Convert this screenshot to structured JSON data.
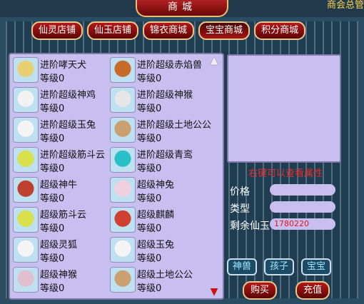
{
  "window": {
    "title": "商城",
    "corner_note": "商会总管"
  },
  "tabs": [
    {
      "label": "仙灵店铺"
    },
    {
      "label": "仙玉店铺"
    },
    {
      "label": "锦衣商城"
    },
    {
      "label": "宝宝商城",
      "active": true
    },
    {
      "label": "积分商城"
    }
  ],
  "items": [
    {
      "name": "进阶哮天犬",
      "level": "等级0",
      "icon": "hound-icon",
      "color": "#e8d070"
    },
    {
      "name": "进阶超级赤焰兽",
      "level": "等级0",
      "icon": "fire-beast-icon",
      "color": "#c86a2a"
    },
    {
      "name": "进阶超级神鸡",
      "level": "等级0",
      "icon": "rooster-icon",
      "color": "#f2f2f2"
    },
    {
      "name": "进阶超级神猴",
      "level": "等级0",
      "icon": "monkey-icon",
      "color": "#e6e6e6"
    },
    {
      "name": "进阶超级玉兔",
      "level": "等级0",
      "icon": "rabbit-icon",
      "color": "#f4f4f4"
    },
    {
      "name": "进阶超级土地公公",
      "level": "等级0",
      "icon": "earth-god-icon",
      "color": "#caa070"
    },
    {
      "name": "进阶超级筋斗云",
      "level": "等级0",
      "icon": "cloud-icon",
      "color": "#d8e04a"
    },
    {
      "name": "进阶超级青鸾",
      "level": "等级0",
      "icon": "phoenix-icon",
      "color": "#2ac0c8"
    },
    {
      "name": "超级神牛",
      "level": "等级0",
      "icon": "ox-icon",
      "color": "#c04030"
    },
    {
      "name": "超级神兔",
      "level": "等级0",
      "icon": "rabbit-icon",
      "color": "#f0d0e0"
    },
    {
      "name": "超级筋斗云",
      "level": "等级0",
      "icon": "cloud-icon",
      "color": "#d8e04a"
    },
    {
      "name": "超级麒麟",
      "level": "等级0",
      "icon": "qilin-icon",
      "color": "#d04030"
    },
    {
      "name": "超级灵狐",
      "level": "等级0",
      "icon": "fox-icon",
      "color": "#f4f4f4"
    },
    {
      "name": "超级玉兔",
      "level": "等级0",
      "icon": "rabbit-icon",
      "color": "#f4f4f4"
    },
    {
      "name": "超级神猴",
      "level": "等级0",
      "icon": "monkey-icon",
      "color": "#e0c0d0"
    },
    {
      "name": "超级土地公公",
      "level": "等级0",
      "icon": "earth-god-icon",
      "color": "#caa070"
    }
  ],
  "preview_hint": "右键可以查看属性",
  "info": {
    "price_label": "价格",
    "price_value": "",
    "type_label": "类型",
    "type_value": "",
    "balance_label": "剩余仙玉",
    "balance_value": "1780220"
  },
  "categories": [
    {
      "label": "神兽"
    },
    {
      "label": "孩子"
    },
    {
      "label": "宝宝"
    }
  ],
  "actions": {
    "buy": "购买",
    "recharge": "充值"
  },
  "colors": {
    "accent": "#b41818",
    "panel": "#c8bff0",
    "balance_text": "#e01818"
  }
}
